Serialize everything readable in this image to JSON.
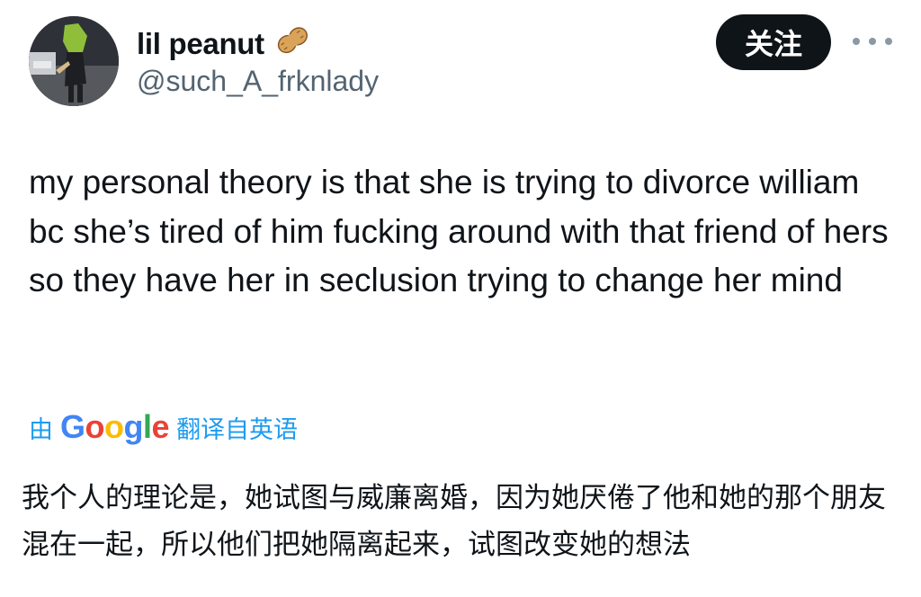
{
  "author": {
    "display_name": "lil peanut",
    "handle": "@such_A_frknlady",
    "name_emoji": "peanut-icon"
  },
  "actions": {
    "follow_label": "关注",
    "more_icon": "more-horizontal-icon"
  },
  "tweet": {
    "text": "my personal theory is that she is trying to divorce william bc she’s tired of him fucking around with that friend of hers so they have her in seclusion trying to change her mind"
  },
  "translation": {
    "by_label": "由",
    "provider_letters": [
      "G",
      "o",
      "o",
      "g",
      "l",
      "e"
    ],
    "translated_from_label": "翻译自英语",
    "text": "我个人的理论是，她试图与威廉离婚，因为她厌倦了他和她的那个朋友混在一起，所以他们把她隔离起来，试图改变她的想法"
  },
  "colors": {
    "link_blue": "#1d9bf0",
    "handle_gray": "#536471",
    "follow_bg": "#0f1419"
  }
}
